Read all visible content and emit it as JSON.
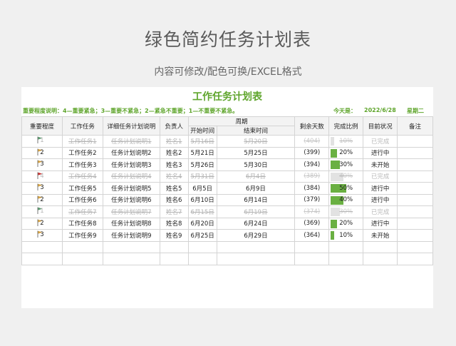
{
  "header": {
    "title": "绿色简约任务计划表",
    "subtitle": "内容可修改/配色可换/EXCEL格式"
  },
  "sheet": {
    "title": "工作任务计划表",
    "legend": "重要程度说明：4—重要紧急；3—重要不紧急；2—紧急不重要；1—不重要不紧急。",
    "today_label": "今天是：",
    "today_date": "2022/6/28",
    "weekday": "星期二"
  },
  "columns": {
    "priority": "重要程度",
    "task": "工作任务",
    "detail": "详细任务计划说明",
    "owner": "负责人",
    "period": "周期",
    "start": "开始时间",
    "end": "结束时间",
    "remaining": "剩余天数",
    "ratio": "完成比例",
    "status": "目前状况",
    "notes": "备注"
  },
  "colors": {
    "accent": "#5fa52c",
    "bar": "#6ab042",
    "overdue": "#d21c1c",
    "flag_green": "#5a9a6e",
    "flag_orange": "#d9a441",
    "flag_red": "#c8302f"
  },
  "rows": [
    {
      "priority": "1",
      "flag": "green",
      "task": "工作任务1",
      "detail": "任务计划说明1",
      "owner": "姓名1",
      "start": "5月16日",
      "end": "5月20日",
      "remaining": "(404)",
      "ratio": "10%",
      "progress": 0.1,
      "status": "已完成"
    },
    {
      "priority": "2",
      "flag": "orange",
      "task": "工作任务2",
      "detail": "任务计划说明2",
      "owner": "姓名2",
      "start": "5月21日",
      "end": "5月25日",
      "remaining": "(399)",
      "ratio": "20%",
      "progress": 0.2,
      "status": "进行中"
    },
    {
      "priority": "3",
      "flag": "orange",
      "task": "工作任务3",
      "detail": "任务计划说明3",
      "owner": "姓名3",
      "start": "5月26日",
      "end": "5月30日",
      "remaining": "(394)",
      "ratio": "30%",
      "progress": 0.3,
      "status": "未开始"
    },
    {
      "priority": "4",
      "flag": "red",
      "task": "工作任务4",
      "detail": "任务计划说明4",
      "owner": "姓名4",
      "start": "5月31日",
      "end": "6月4日",
      "remaining": "(389)",
      "ratio": "40%",
      "progress": 0.4,
      "status": "已完成"
    },
    {
      "priority": "3",
      "flag": "orange",
      "task": "工作任务5",
      "detail": "任务计划说明5",
      "owner": "姓名5",
      "start": "6月5日",
      "end": "6月9日",
      "remaining": "(384)",
      "ratio": "50%",
      "progress": 0.5,
      "status": "进行中"
    },
    {
      "priority": "2",
      "flag": "orange",
      "task": "工作任务6",
      "detail": "任务计划说明6",
      "owner": "姓名6",
      "start": "6月10日",
      "end": "6月14日",
      "remaining": "(379)",
      "ratio": "40%",
      "progress": 0.4,
      "status": "进行中"
    },
    {
      "priority": "1",
      "flag": "green",
      "task": "工作任务7",
      "detail": "任务计划说明7",
      "owner": "姓名7",
      "start": "6月15日",
      "end": "6月19日",
      "remaining": "(374)",
      "ratio": "30%",
      "progress": 0.3,
      "status": "已完成"
    },
    {
      "priority": "2",
      "flag": "orange",
      "task": "工作任务8",
      "detail": "任务计划说明8",
      "owner": "姓名8",
      "start": "6月20日",
      "end": "6月24日",
      "remaining": "(369)",
      "ratio": "20%",
      "progress": 0.2,
      "status": "进行中"
    },
    {
      "priority": "3",
      "flag": "orange",
      "task": "工作任务9",
      "detail": "任务计划说明9",
      "owner": "姓名9",
      "start": "6月25日",
      "end": "6月29日",
      "remaining": "(364)",
      "ratio": "10%",
      "progress": 0.1,
      "status": "未开始"
    }
  ]
}
